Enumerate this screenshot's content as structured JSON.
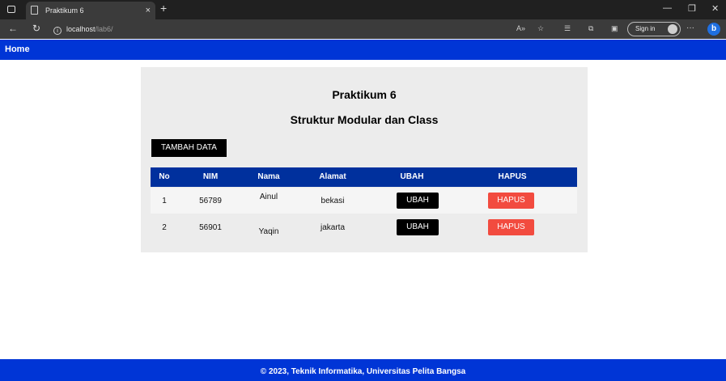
{
  "browser": {
    "tab_title": "Praktikum 6",
    "tab_close": "×",
    "new_tab": "+",
    "url_host": "localhost",
    "url_path": "/lab6/",
    "sign_in": "Sign in",
    "more": "···",
    "minimize": "—",
    "restore": "❐",
    "close": "✕"
  },
  "navbar": {
    "home": "Home"
  },
  "main": {
    "title": "Praktikum 6",
    "subtitle": "Struktur Modular dan Class",
    "add_button": "TAMBAH DATA",
    "columns": [
      "No",
      "NIM",
      "Nama",
      "Alamat",
      "UBAH",
      "HAPUS"
    ],
    "rows": [
      {
        "no": "1",
        "nim": "56789",
        "nama": "Ainul",
        "alamat": "bekasi",
        "ubah": "UBAH",
        "hapus": "HAPUS"
      },
      {
        "no": "2",
        "nim": "56901",
        "nama": "Yaqin",
        "alamat": "jakarta",
        "ubah": "UBAH",
        "hapus": "HAPUS"
      }
    ]
  },
  "footer": {
    "text": "© 2023, Teknik Informatika, Universitas Pelita Bangsa"
  },
  "colors": {
    "navbar": "#0035d6",
    "table_header": "#00309d",
    "hapus": "#f24b3f",
    "card": "#ececec"
  }
}
